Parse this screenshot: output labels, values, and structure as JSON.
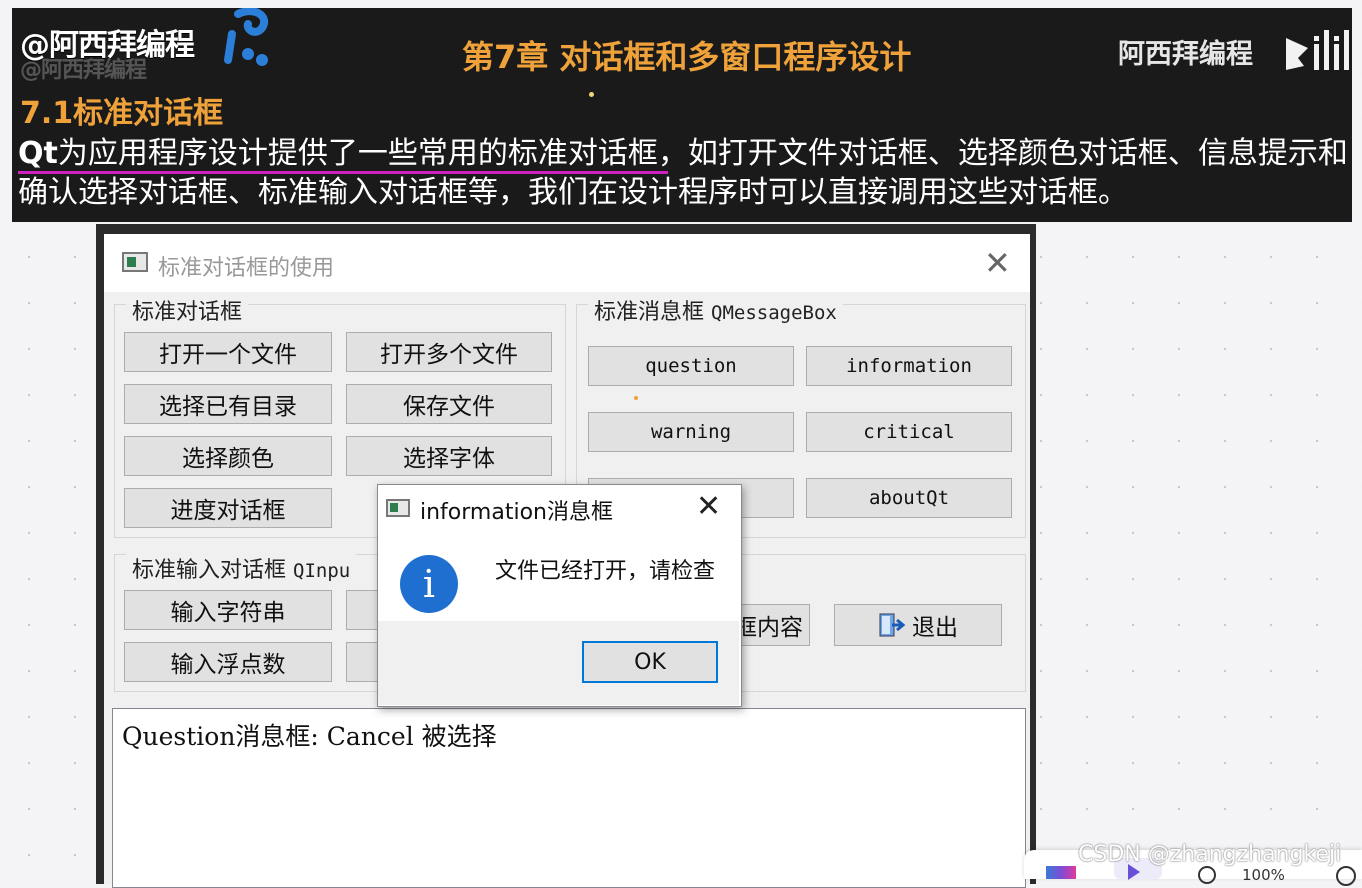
{
  "banner": {
    "watermark_left": "@阿西拜编程",
    "chapter_title": "第7章 对话框和多窗口程序设计",
    "watermark_right": "阿西拜编程",
    "section_title": "7.1标准对话框",
    "paragraph_lead": "Qt",
    "paragraph_rest": "为应用程序设计提供了一些常用的标准对话框，如打开文件对话框、选择颜色对话框、信息提示和确认选择对话框、标准输入对话框等，我们在设计程序时可以直接调用这些对话框。"
  },
  "window": {
    "title": "标准对话框的使用",
    "close_glyph": "✕",
    "std_dialogs": {
      "title": "标准对话框",
      "buttons": [
        "打开一个文件",
        "打开多个文件",
        "选择已有目录",
        "保存文件",
        "选择颜色",
        "选择字体",
        "进度对话框"
      ]
    },
    "msgbox": {
      "title": "标准消息框",
      "title_class": "QMessageBox",
      "buttons": [
        "question",
        "information",
        "warning",
        "critical",
        "aboutQt"
      ]
    },
    "input": {
      "title": "标准输入对话框",
      "title_class": "QInpu",
      "buttons": [
        "输入字符串",
        "输入浮点数"
      ]
    },
    "bottom_buttons": {
      "clear_partial": "框内容",
      "exit": "退出"
    },
    "output_text": "Question消息框: Cancel 被选择"
  },
  "dialog": {
    "title": "information消息框",
    "close_glyph": "✕",
    "icon_glyph": "i",
    "message": "文件已经打开，请检查",
    "ok_label": "OK"
  },
  "overlay": {
    "csdn_watermark": "CSDN @zhangzhangkeji",
    "zoom_text": "100%"
  },
  "icons": [
    "logo-note-icon",
    "bilibili-logo",
    "app-window-icon",
    "close-icon",
    "info-icon",
    "exit-door-icon",
    "zoom-icon",
    "info-circle-icon"
  ]
}
